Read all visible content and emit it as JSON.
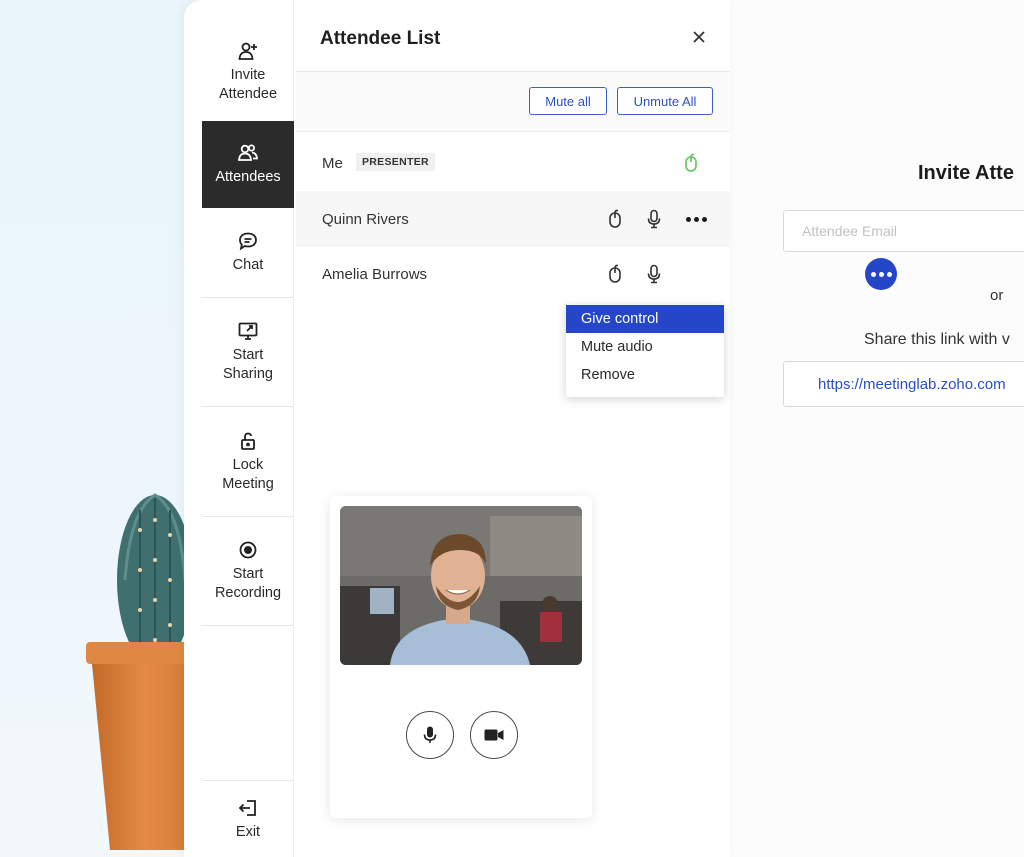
{
  "sidebar": {
    "items": [
      {
        "icon": "add-person-icon",
        "label": "Invite\nAttendee"
      },
      {
        "icon": "attendees-icon",
        "label": "Attendees",
        "active": true
      },
      {
        "icon": "chat-icon",
        "label": "Chat"
      },
      {
        "icon": "screen-share-icon",
        "label": "Start\nSharing"
      },
      {
        "icon": "lock-icon",
        "label": "Lock\nMeeting"
      },
      {
        "icon": "record-icon",
        "label": "Start\nRecording"
      },
      {
        "icon": "exit-icon",
        "label": "Exit"
      }
    ]
  },
  "panel": {
    "title": "Attendee List",
    "mute_all": "Mute all",
    "unmute_all": "Unmute All"
  },
  "attendees": [
    {
      "name": "Me",
      "badge": "PRESENTER"
    },
    {
      "name": "Quinn Rivers"
    },
    {
      "name": "Amelia Burrows"
    }
  ],
  "context_menu": {
    "items": [
      "Give control",
      "Mute audio",
      "Remove"
    ],
    "highlighted": "Give control"
  },
  "invite": {
    "title": "Invite Atte",
    "email_placeholder": "Attendee Email",
    "or_text": "or",
    "share_text": "Share this link with v",
    "link": "https://meetinglab.zoho.com"
  },
  "colors": {
    "accent": "#2446c7",
    "active_sidebar": "#2b2b2b",
    "presenter_mouse": "#5fc45a"
  }
}
